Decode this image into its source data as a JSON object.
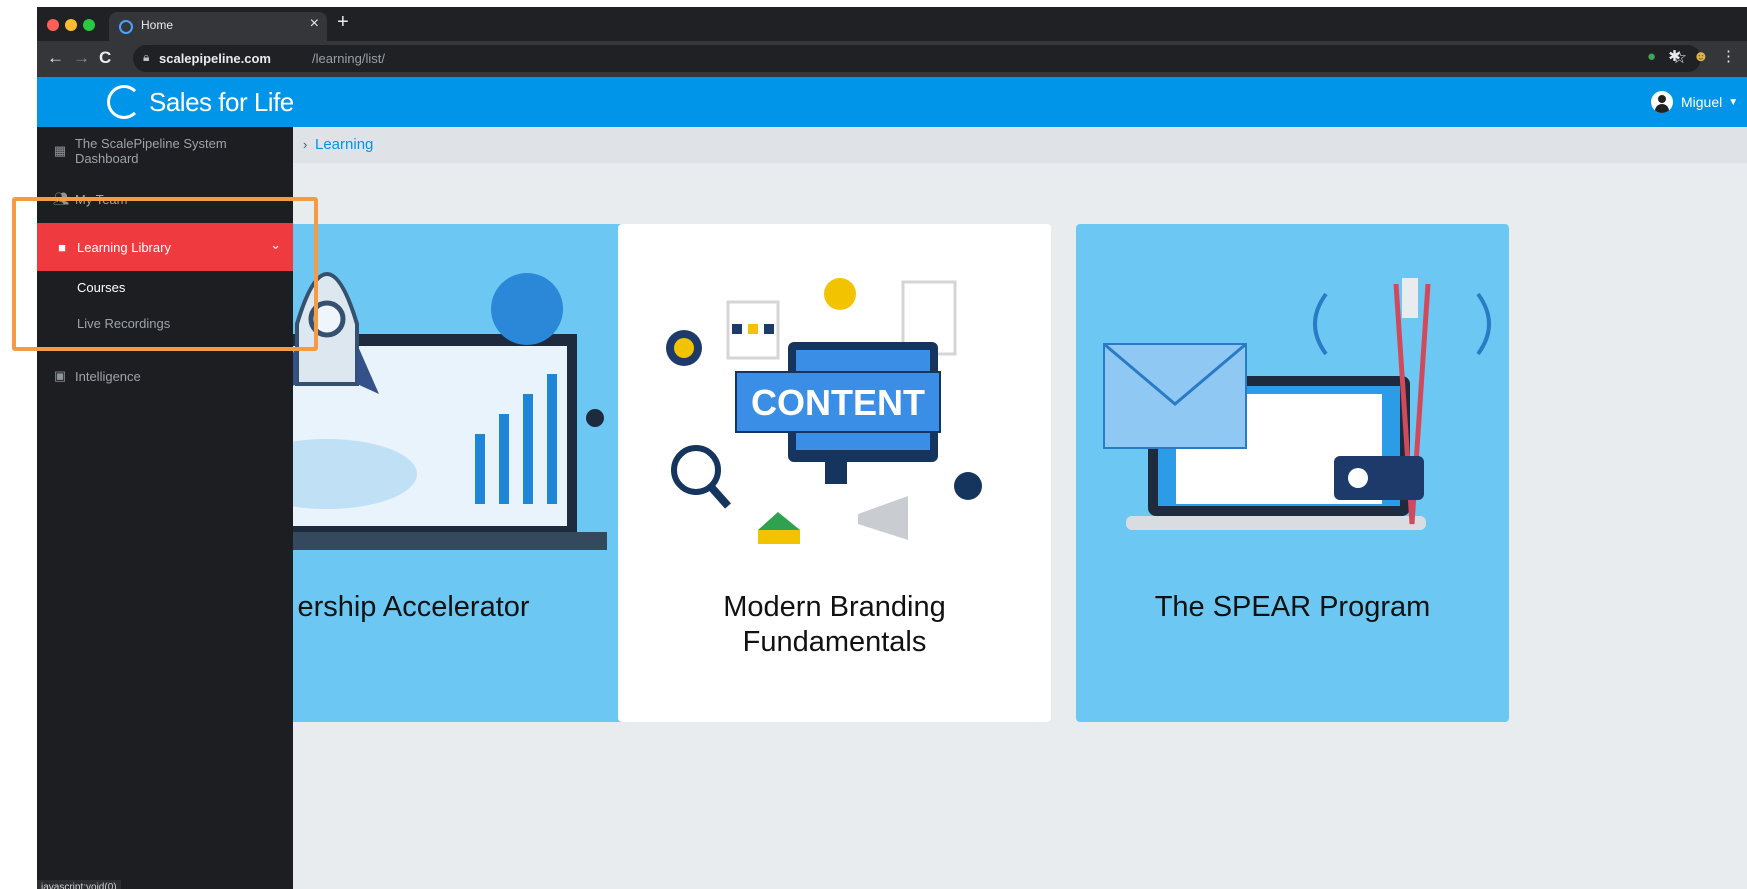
{
  "browser": {
    "tab_title": "Home",
    "tab_close": "×",
    "new_tab": "+",
    "url_host": "scalepipeline.com",
    "url_path": "/learning/list/",
    "status_url": "javascript:void(0)"
  },
  "header": {
    "logo_text": "Sales for Life",
    "user_name": "Miguel"
  },
  "breadcrumb": {
    "separator": "›",
    "current": "Learning"
  },
  "sidebar": {
    "items": [
      {
        "label": "The ScalePipeline System Dashboard",
        "icon": "dashboard-icon"
      },
      {
        "label": "My Team",
        "icon": "team-icon"
      },
      {
        "label": "Learning Library",
        "icon": "video-camera-icon"
      },
      {
        "label": "Intelligence",
        "icon": "inbox-icon"
      }
    ],
    "subitems": [
      {
        "label": "Courses"
      },
      {
        "label": "Live Recordings"
      }
    ]
  },
  "courses": [
    {
      "title": "ership Accelerator"
    },
    {
      "title": "Modern Branding Fundamentals",
      "badge_text": "CONTENT"
    },
    {
      "title": "The SPEAR Program"
    }
  ],
  "colors": {
    "header_blue": "#0095e9",
    "active_red": "#ef3b3f",
    "card_blue": "#6cc8f2",
    "highlight_orange": "#f59b43"
  }
}
